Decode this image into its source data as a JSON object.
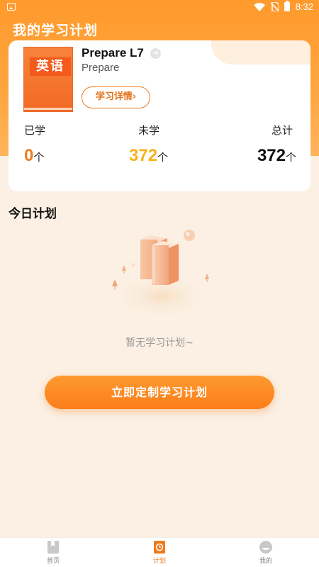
{
  "status_bar": {
    "time": "8:32"
  },
  "page_title": "我的学习计划",
  "course": {
    "cover_label": "英语",
    "name": "Prepare L7",
    "subtitle": "Prepare",
    "detail_button": "学习详情›"
  },
  "stats": {
    "learned": {
      "label": "已学",
      "value": "0",
      "unit": "个",
      "color": "#ef7a1c"
    },
    "unlearned": {
      "label": "未学",
      "value": "372",
      "unit": "个",
      "color": "#f7b21c"
    },
    "total": {
      "label": "总计",
      "value": "372",
      "unit": "个",
      "color": "#111111"
    }
  },
  "today_section": {
    "title": "今日计划",
    "empty_text": "暂无学习计划~"
  },
  "cta_button": "立即定制学习计划",
  "bottom_nav": [
    {
      "label": "首页",
      "icon": "home-book-icon",
      "active": false
    },
    {
      "label": "计划",
      "icon": "plan-clock-icon",
      "active": true
    },
    {
      "label": "我的",
      "icon": "profile-face-icon",
      "active": false
    }
  ],
  "colors": {
    "accent": "#ef7a1c",
    "background": "#fbf0e3",
    "header": "#ff9a2c"
  }
}
